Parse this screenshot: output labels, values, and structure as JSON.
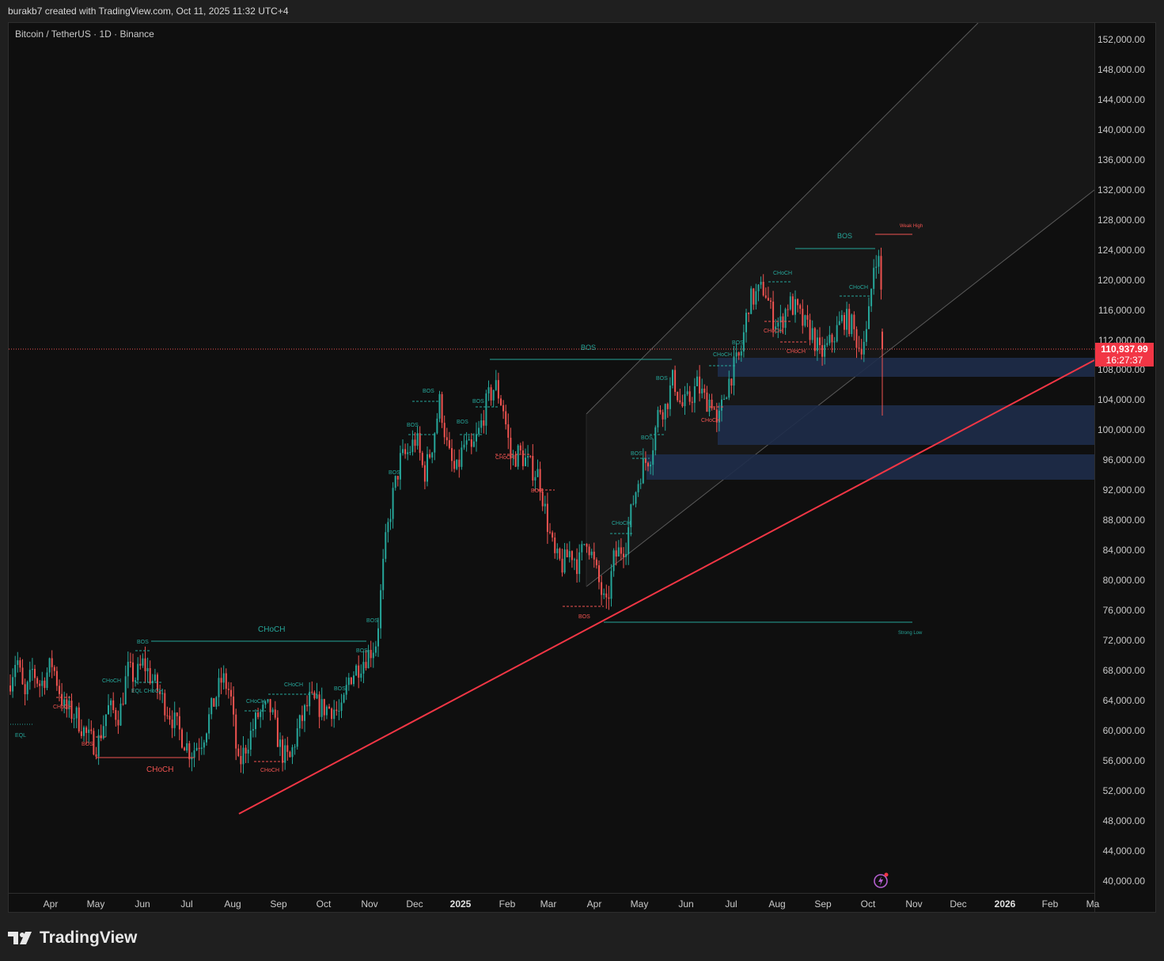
{
  "header": {
    "attribution": "burakb7 created with TradingView.com, Oct 11, 2025 11:32 UTC+4"
  },
  "chart": {
    "symbol": "Bitcoin / TetherUS · 1D · Binance",
    "price_badge": {
      "price": "110,937.99",
      "countdown": "16:27:37"
    },
    "y_ticks": [
      "152,000.00",
      "148,000.00",
      "144,000.00",
      "140,000.00",
      "136,000.00",
      "132,000.00",
      "128,000.00",
      "124,000.00",
      "120,000.00",
      "116,000.00",
      "112,000.00",
      "108,000.00",
      "104,000.00",
      "100,000.00",
      "96,000.00",
      "92,000.00",
      "88,000.00",
      "84,000.00",
      "80,000.00",
      "76,000.00",
      "72,000.00",
      "68,000.00",
      "64,000.00",
      "60,000.00",
      "56,000.00",
      "52,000.00",
      "48,000.00",
      "44,000.00",
      "40,000.00"
    ],
    "x_ticks": [
      {
        "label": "Apr",
        "bold": false
      },
      {
        "label": "May",
        "bold": false
      },
      {
        "label": "Jun",
        "bold": false
      },
      {
        "label": "Jul",
        "bold": false
      },
      {
        "label": "Aug",
        "bold": false
      },
      {
        "label": "Sep",
        "bold": false
      },
      {
        "label": "Oct",
        "bold": false
      },
      {
        "label": "Nov",
        "bold": false
      },
      {
        "label": "Dec",
        "bold": false
      },
      {
        "label": "2025",
        "bold": true
      },
      {
        "label": "Feb",
        "bold": false
      },
      {
        "label": "Mar",
        "bold": false
      },
      {
        "label": "Apr",
        "bold": false
      },
      {
        "label": "May",
        "bold": false
      },
      {
        "label": "Jun",
        "bold": false
      },
      {
        "label": "Jul",
        "bold": false
      },
      {
        "label": "Aug",
        "bold": false
      },
      {
        "label": "Sep",
        "bold": false
      },
      {
        "label": "Oct",
        "bold": false
      },
      {
        "label": "Nov",
        "bold": false
      },
      {
        "label": "Dec",
        "bold": false
      },
      {
        "label": "2026",
        "bold": true
      },
      {
        "label": "Feb",
        "bold": false
      },
      {
        "label": "Ma",
        "bold": false
      }
    ],
    "annotations": {
      "bos": "BOS",
      "choch": "CHoCH",
      "eql": "EQL",
      "eql_choch": "EQL CHoCH",
      "weak_high": "Weak High",
      "strong_low": "Strong Low"
    },
    "colors": {
      "bull": "#26a69a",
      "bear": "#ef5350",
      "trendline": "#f23645",
      "zone": "#1e2c4a"
    }
  },
  "footer": {
    "brand": "TradingView"
  }
}
